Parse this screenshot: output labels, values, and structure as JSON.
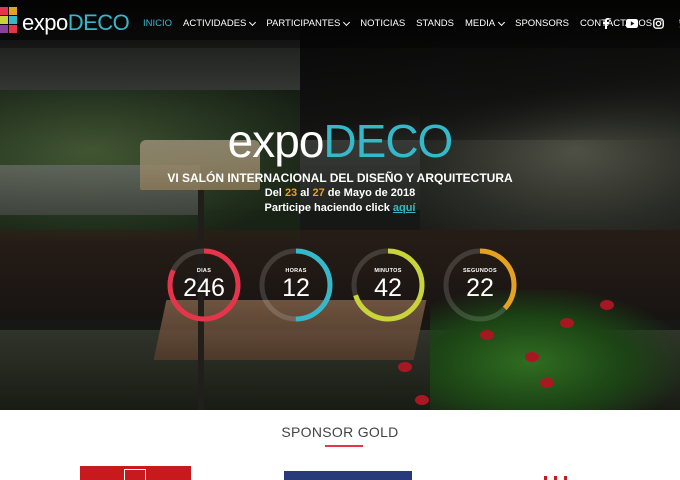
{
  "nav": {
    "logo": {
      "part1": "expo",
      "part2": "DECO"
    },
    "items": [
      {
        "label": "INICIO",
        "active": true,
        "dropdown": false
      },
      {
        "label": "ACTIVIDADES",
        "active": false,
        "dropdown": true
      },
      {
        "label": "PARTICIPANTES",
        "active": false,
        "dropdown": true
      },
      {
        "label": "NOTICIAS",
        "active": false,
        "dropdown": false
      },
      {
        "label": "STANDS",
        "active": false,
        "dropdown": false
      },
      {
        "label": "MEDIA",
        "active": false,
        "dropdown": true
      },
      {
        "label": "SPONSORS",
        "active": false,
        "dropdown": false
      },
      {
        "label": "CONTÁCTANOS",
        "active": false,
        "dropdown": false
      }
    ],
    "social": [
      "facebook-icon",
      "youtube-icon",
      "instagram-icon",
      "twitter-icon"
    ]
  },
  "hero": {
    "logo": {
      "part1": "expo",
      "part2": "DECO"
    },
    "title": "VI SALÓN INTERNACIONAL DEL DISEÑO Y ARQUITECTURA",
    "dates": {
      "prefix": "Del ",
      "start": "23",
      "mid": " al ",
      "end": "27",
      "suffix": " de Mayo de 2018"
    },
    "cta": {
      "text": "Participe haciendo click ",
      "link": "aquí"
    }
  },
  "countdown": [
    {
      "label": "DIAS",
      "value": "246",
      "color": "#e6344a",
      "fraction": 0.82
    },
    {
      "label": "HORAS",
      "value": "12",
      "color": "#35b8c9",
      "fraction": 0.5
    },
    {
      "label": "MINUTOS",
      "value": "42",
      "color": "#c8d43a",
      "fraction": 0.7
    },
    {
      "label": "SEGUNDOS",
      "value": "22",
      "color": "#e5a21f",
      "fraction": 0.37
    }
  ],
  "sponsors": {
    "title": "SPONSOR GOLD"
  },
  "colors": {
    "accent": "#35b8c9",
    "brand_red": "#e6344a",
    "highlight": "#e5a21f"
  }
}
